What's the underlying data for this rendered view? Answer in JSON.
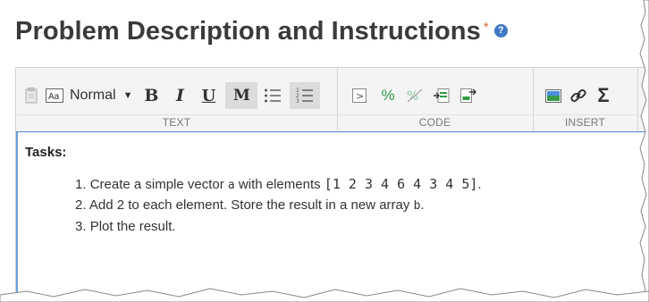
{
  "header": {
    "title": "Problem Description and Instructions",
    "required_marker": "*",
    "help_icon": "?"
  },
  "toolbar": {
    "text_group": {
      "label": "TEXT",
      "style_value": "Normal",
      "bold": "B",
      "italic": "I",
      "underline": "U",
      "monospace": "M",
      "icons": [
        "paste-icon",
        "text-style-icon",
        "bulleted-list-icon",
        "numbered-list-icon"
      ]
    },
    "code_group": {
      "label": "CODE",
      "inline_code_label": ">",
      "percent_label": "%",
      "icons": [
        "inline-code-icon",
        "comment-icon",
        "uncomment-icon",
        "insert-code-icon",
        "insert-code-below-icon"
      ]
    },
    "insert_group": {
      "label": "INSERT",
      "equation_label": "Σ",
      "icons": [
        "image-icon",
        "link-icon",
        "equation-icon"
      ]
    }
  },
  "content": {
    "heading": "Tasks:",
    "items": [
      {
        "num": "1.",
        "prefix": "Create a simple vector ",
        "code": "a",
        "middle": " with elements ",
        "code2": "[1 2 3 4 6 4 3 4 5]",
        "suffix": "."
      },
      {
        "num": "2.",
        "prefix": "Add 2 to each element. Store the result in a new array ",
        "code": "b",
        "suffix": "."
      },
      {
        "num": "3.",
        "text": "Plot the result."
      }
    ]
  },
  "colors": {
    "accent_blue": "#4b86d6",
    "required_orange": "#e06b3a",
    "toolbar_bg": "#f4f4f4",
    "code_green": "#2e9b48"
  }
}
